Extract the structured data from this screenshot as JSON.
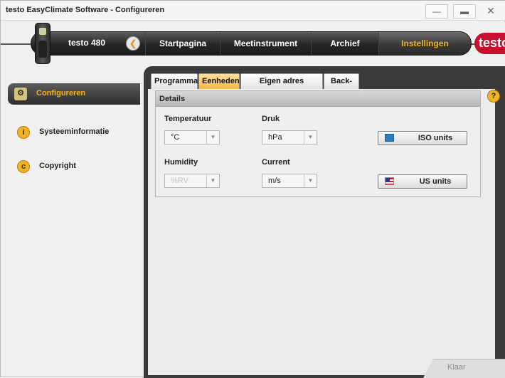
{
  "window": {
    "title": "testo EasyClimate Software - Configureren",
    "min_glyph": "—",
    "max_glyph": "▬",
    "close_glyph": "✕"
  },
  "nav": {
    "device_name": "testo 480",
    "back_glyph": "❮",
    "tabs": [
      "Startpagina",
      "Meetinstrument",
      "Archief",
      "Instellingen"
    ],
    "active_tab": "Instellingen",
    "logo_text": "testo",
    "brand_color": "#c8102e",
    "accent_color": "#f5b21a"
  },
  "sidebar": {
    "items": [
      {
        "label": "Configureren",
        "icon": "configure-icon",
        "glyph": "⚙",
        "active": true
      },
      {
        "label": "Systeeminformatie",
        "icon": "info-icon",
        "glyph": "i",
        "active": false
      },
      {
        "label": "Copyright",
        "icon": "copyright-icon",
        "glyph": "c",
        "active": false
      }
    ]
  },
  "tabs": {
    "items": [
      "Programma",
      "Eenheden",
      "Eigen adres gegevens",
      "Back-up"
    ],
    "active": "Eenheden"
  },
  "details": {
    "title": "Details",
    "fields": {
      "temperatuur": {
        "label": "Temperatuur",
        "value": "°C",
        "disabled": false
      },
      "druk": {
        "label": "Druk",
        "value": "hPa",
        "disabled": false
      },
      "humidity": {
        "label": "Humidity",
        "value": "%RV",
        "disabled": true
      },
      "current": {
        "label": "Current",
        "value": "m/s",
        "disabled": false
      }
    },
    "dropdown_arrow": "▼",
    "buttons": {
      "iso": "ISO units",
      "us": "US units"
    }
  },
  "help_glyph": "?",
  "footer": {
    "klaar": "Klaar"
  }
}
